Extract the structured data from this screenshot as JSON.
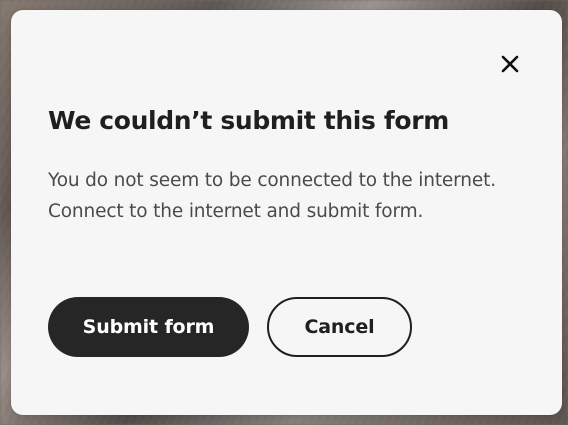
{
  "dialog": {
    "title": "We couldn’t submit this form",
    "message": "You do not seem to be connected to the internet. Connect to the internet and submit form.",
    "close_icon": "close-icon",
    "buttons": {
      "submit_label": "Submit form",
      "cancel_label": "Cancel"
    },
    "colors": {
      "dialog_background": "#f6f6f6",
      "primary_button": "#262626",
      "text": "#1f1f1f"
    }
  }
}
